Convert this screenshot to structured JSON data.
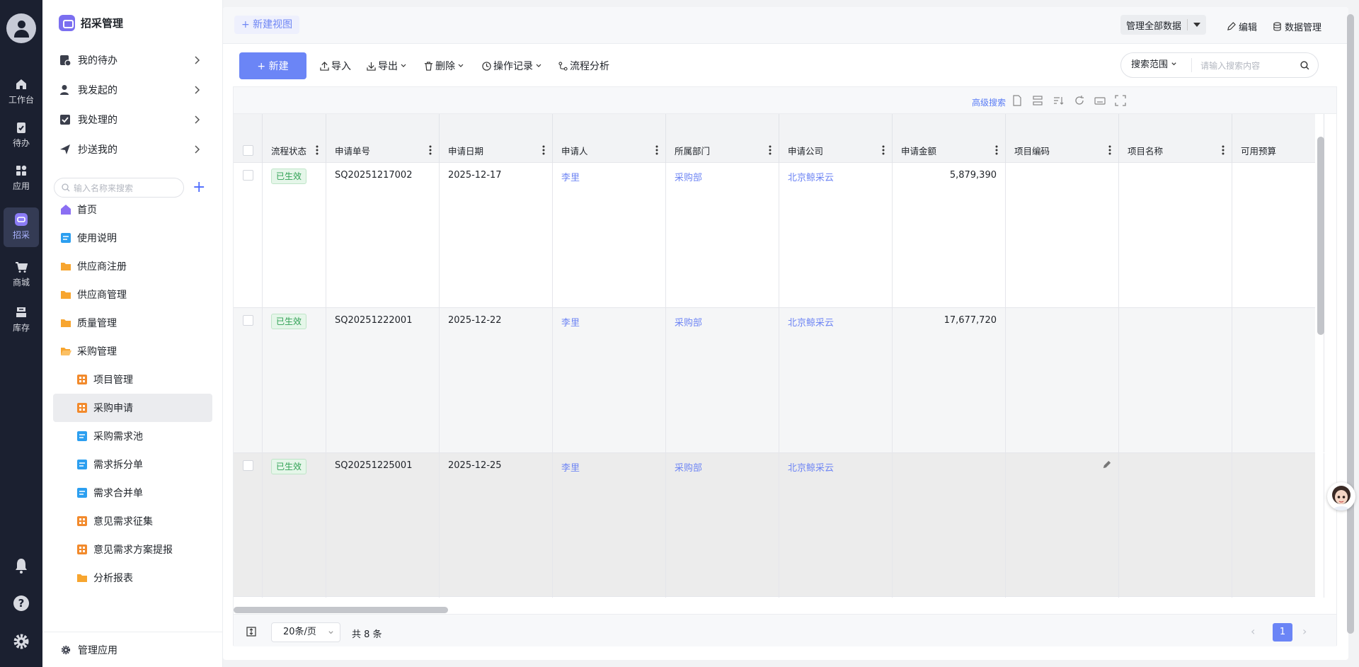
{
  "rail": {
    "items": [
      {
        "label": "工作台"
      },
      {
        "label": "待办"
      },
      {
        "label": "应用"
      },
      {
        "label": "招采"
      },
      {
        "label": "商城"
      },
      {
        "label": "库存"
      }
    ]
  },
  "app": {
    "title": "招采管理"
  },
  "groups": [
    {
      "label": "我的待办"
    },
    {
      "label": "我发起的"
    },
    {
      "label": "我处理的"
    },
    {
      "label": "抄送我的"
    }
  ],
  "search": {
    "placeholder": "输入名称来搜索"
  },
  "tree": [
    {
      "label": "首页",
      "icon": "home"
    },
    {
      "label": "使用说明",
      "icon": "doc"
    },
    {
      "label": "供应商注册",
      "icon": "folder"
    },
    {
      "label": "供应商管理",
      "icon": "folder"
    },
    {
      "label": "质量管理",
      "icon": "folder"
    },
    {
      "label": "采购管理",
      "icon": "folder-open"
    },
    {
      "label": "项目管理",
      "icon": "grid"
    },
    {
      "label": "采购申请",
      "icon": "grid"
    },
    {
      "label": "采购需求池",
      "icon": "doc"
    },
    {
      "label": "需求拆分单",
      "icon": "doc"
    },
    {
      "label": "需求合并单",
      "icon": "doc"
    },
    {
      "label": "意见需求征集",
      "icon": "grid"
    },
    {
      "label": "意见需求方案提报",
      "icon": "grid"
    },
    {
      "label": "分析报表",
      "icon": "folder"
    }
  ],
  "manage_app": "管理应用",
  "topbar": {
    "new_view": "+ 新建视图",
    "manage_all": "管理全部数据",
    "edit": "编辑",
    "data_manage": "数据管理"
  },
  "toolbar": {
    "new": "+ 新建",
    "import": "导入",
    "export": "导出",
    "delete": "删除",
    "op_log": "操作记录",
    "flow": "流程分析",
    "scope": "搜索范围",
    "search_ph": "请输入搜索内容"
  },
  "grid_tools": {
    "advanced": "高级搜索"
  },
  "columns": [
    "流程状态",
    "申请单号",
    "申请日期",
    "申请人",
    "所属部门",
    "申请公司",
    "申请金额",
    "项目编码",
    "项目名称",
    "可用预算"
  ],
  "rows": [
    {
      "status": "已生效",
      "no": "SQ20251217002",
      "date": "2025-12-17",
      "applicant": "李里",
      "dept": "采购部",
      "company": "北京鲸采云",
      "amount": "5,879,390",
      "code": "",
      "name": "",
      "budget": ""
    },
    {
      "status": "已生效",
      "no": "SQ20251222001",
      "date": "2025-12-22",
      "applicant": "李里",
      "dept": "采购部",
      "company": "北京鲸采云",
      "amount": "17,677,720",
      "code": "",
      "name": "",
      "budget": ""
    },
    {
      "status": "已生效",
      "no": "SQ20251225001",
      "date": "2025-12-25",
      "applicant": "李里",
      "dept": "采购部",
      "company": "北京鲸采云",
      "amount": "",
      "code": "",
      "name": "",
      "budget": ""
    }
  ],
  "footer": {
    "page_size": "20条/页",
    "total": "共 8 条",
    "page": "1"
  },
  "colors": {
    "rail": "#1b2030",
    "accent": "#6b85f6",
    "link": "#6f86f4",
    "badge": "#31a155"
  }
}
